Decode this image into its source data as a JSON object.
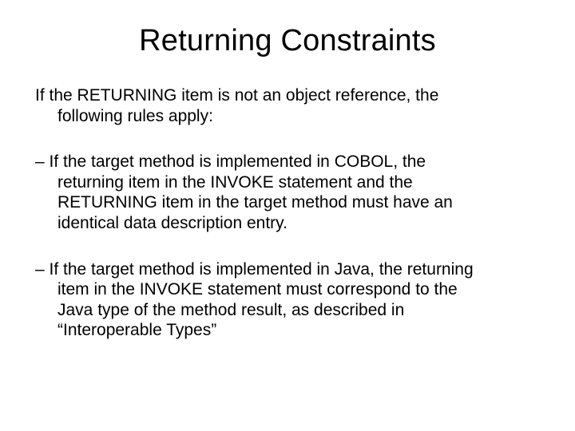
{
  "title": "Returning Constraints",
  "intro_line1": "If the RETURNING item is not an object reference, the",
  "intro_line2": "following rules apply:",
  "bullet1_l1": "– If the target method is implemented in COBOL, the",
  "bullet1_l2": "returning item in the INVOKE statement and the",
  "bullet1_l3": "RETURNING item in the target method must have an",
  "bullet1_l4": "identical data description entry.",
  "bullet2_l1": "– If the target method is implemented in Java, the returning",
  "bullet2_l2": "item in the INVOKE statement must correspond to the",
  "bullet2_l3": "Java type of the method result, as described in",
  "bullet2_l4": "“Interoperable Types”"
}
